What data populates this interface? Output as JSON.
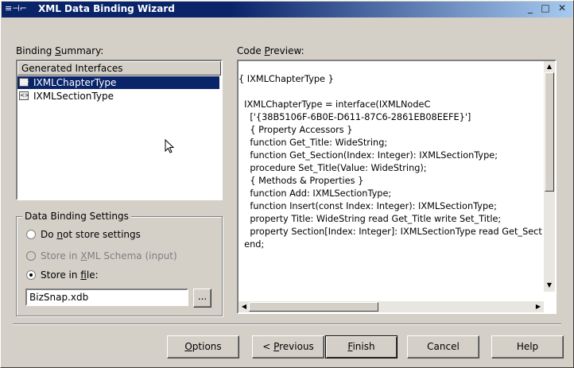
{
  "window": {
    "title": "XML Data Binding Wizard",
    "icons": "≡⊣⌐",
    "min_glyph": "_",
    "max_glyph": "□",
    "close_glyph": "✕"
  },
  "binding_summary": {
    "label_pre": "Binding ",
    "label_ul": "S",
    "label_post": "ummary:",
    "header": "Generated Interfaces",
    "items": [
      {
        "label": "IXMLChapterType",
        "selected": true
      },
      {
        "label": "IXMLSectionType",
        "selected": false
      }
    ]
  },
  "settings": {
    "title": "Data Binding Settings",
    "options": [
      {
        "pre": "Do ",
        "ul": "n",
        "post": "ot store settings",
        "checked": false,
        "disabled": false
      },
      {
        "pre": "Store in ",
        "ul": "X",
        "post": "ML Schema (input)",
        "checked": false,
        "disabled": true
      },
      {
        "pre": "Store in ",
        "ul": "f",
        "post": "ile:",
        "checked": true,
        "disabled": false
      }
    ],
    "file_value": "BizSnap.xdb",
    "browse_label": "..."
  },
  "code_preview": {
    "label_pre": "Code ",
    "label_ul": "P",
    "label_post": "review:",
    "lines": [
      "{ IXMLChapterType }",
      "",
      "  IXMLChapterType = interface(IXMLNodeC",
      "    ['{38B5106F-6B0E-D611-87C6-2861EB08EEFE}']",
      "    { Property Accessors }",
      "    function Get_Title: WideString;",
      "    function Get_Section(Index: Integer): IXMLSectionType;",
      "    procedure Set_Title(Value: WideString);",
      "    { Methods & Properties }",
      "    function Add: IXMLSectionType;",
      "    function Insert(const Index: Integer): IXMLSectionType;",
      "    property Title: WideString read Get_Title write Set_Title;",
      "    property Section[Index: Integer]: IXMLSectionType read Get_Secti",
      "  end;"
    ]
  },
  "buttons": {
    "options": "Options",
    "previous_pre": "< ",
    "previous_ul": "P",
    "previous_post": "revious",
    "finish_ul": "F",
    "finish_post": "inish",
    "cancel": "Cancel",
    "help": "Help"
  }
}
